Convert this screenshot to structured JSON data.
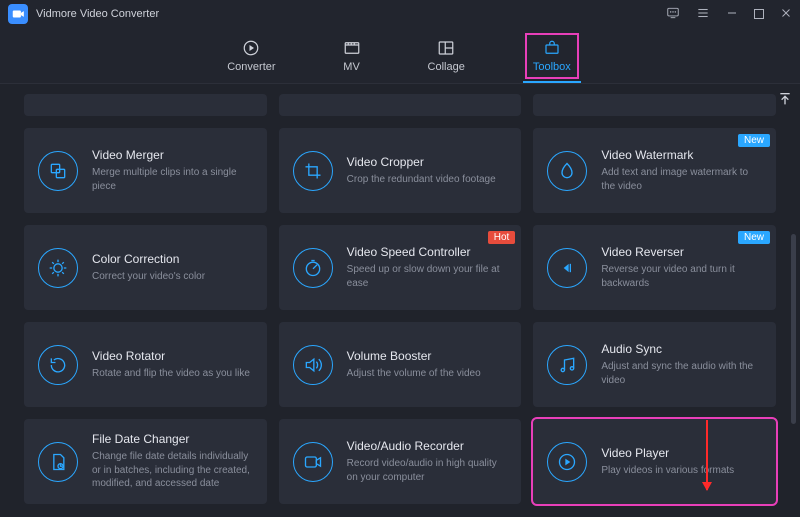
{
  "app_title": "Vidmore Video Converter",
  "tabs": [
    {
      "id": "converter",
      "label": "Converter"
    },
    {
      "id": "mv",
      "label": "MV"
    },
    {
      "id": "collage",
      "label": "Collage"
    },
    {
      "id": "toolbox",
      "label": "Toolbox"
    }
  ],
  "active_tab": "toolbox",
  "badges": {
    "new": "New",
    "hot": "Hot"
  },
  "tools": [
    {
      "id": "video-merger",
      "title": "Video Merger",
      "desc": "Merge multiple clips into a single piece"
    },
    {
      "id": "video-cropper",
      "title": "Video Cropper",
      "desc": "Crop the redundant video footage"
    },
    {
      "id": "video-watermark",
      "title": "Video Watermark",
      "desc": "Add text and image watermark to the video",
      "badge": "new"
    },
    {
      "id": "color-correction",
      "title": "Color Correction",
      "desc": "Correct your video's color"
    },
    {
      "id": "speed-controller",
      "title": "Video Speed Controller",
      "desc": "Speed up or slow down your file at ease",
      "badge": "hot"
    },
    {
      "id": "video-reverser",
      "title": "Video Reverser",
      "desc": "Reverse your video and turn it backwards",
      "badge": "new"
    },
    {
      "id": "video-rotator",
      "title": "Video Rotator",
      "desc": "Rotate and flip the video as you like"
    },
    {
      "id": "volume-booster",
      "title": "Volume Booster",
      "desc": "Adjust the volume of the video"
    },
    {
      "id": "audio-sync",
      "title": "Audio Sync",
      "desc": "Adjust and sync the audio with the video"
    },
    {
      "id": "file-date-changer",
      "title": "File Date Changer",
      "desc": "Change file date details individually or in batches, including the created, modified, and accessed date"
    },
    {
      "id": "av-recorder",
      "title": "Video/Audio Recorder",
      "desc": "Record video/audio in high quality on your computer"
    },
    {
      "id": "video-player",
      "title": "Video Player",
      "desc": "Play videos in various formats",
      "highlight": true
    }
  ],
  "colors": {
    "accent": "#2aa7ff",
    "highlight": "#e83fb9",
    "hot": "#e74c3c"
  }
}
